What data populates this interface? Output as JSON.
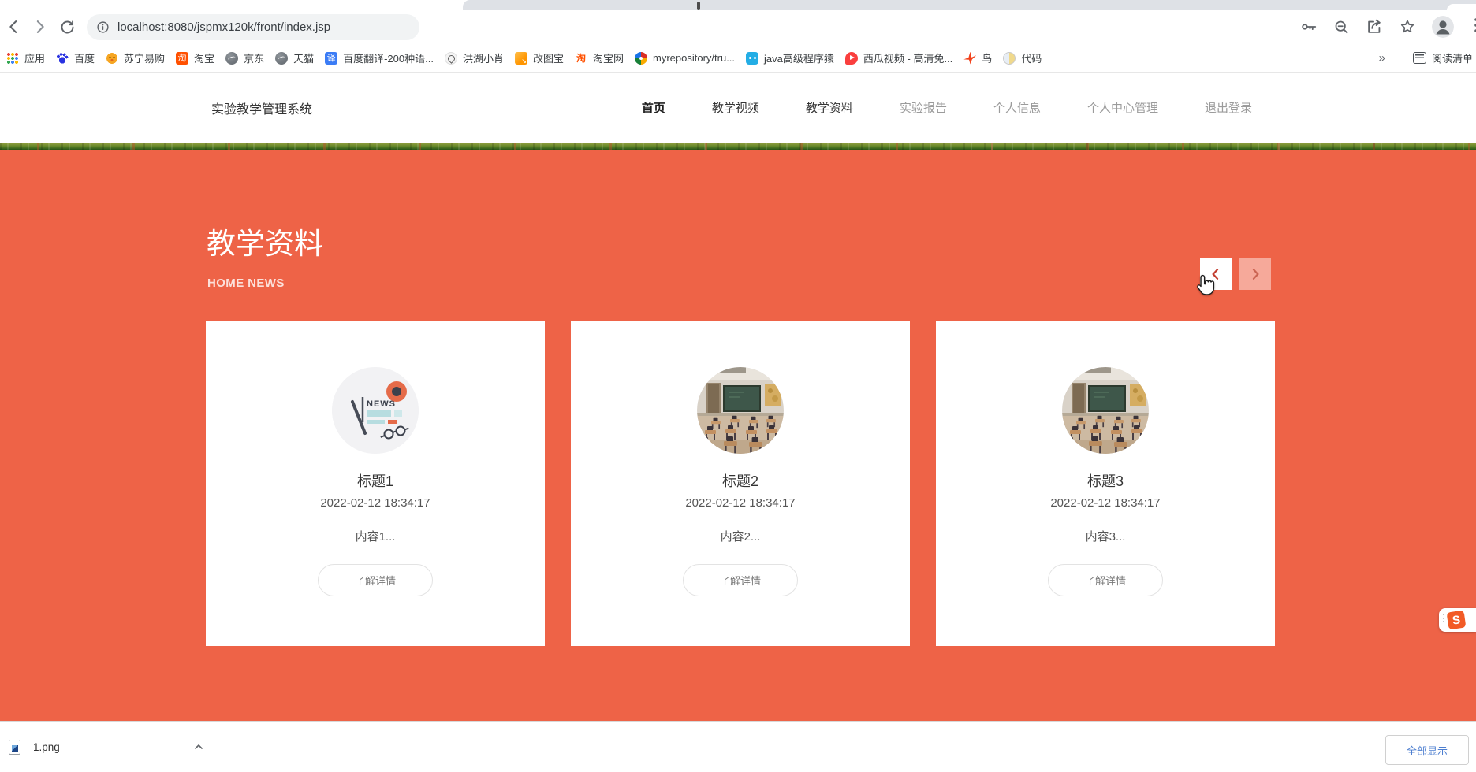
{
  "browser": {
    "url": "localhost:8080/jspmx120k/front/index.jsp",
    "bookmarks": [
      {
        "label": "应用",
        "icon": "apps"
      },
      {
        "label": "百度",
        "icon": "baidu-paw"
      },
      {
        "label": "苏宁易购",
        "icon": "suning-lion"
      },
      {
        "label": "淘宝",
        "icon": "taobao"
      },
      {
        "label": "京东",
        "icon": "globe"
      },
      {
        "label": "天猫",
        "icon": "globe"
      },
      {
        "label": "百度翻译-200种语...",
        "icon": "translate"
      },
      {
        "label": "洪湖小肖",
        "icon": "bird-sketch"
      },
      {
        "label": "改图宝",
        "icon": "gaitubao"
      },
      {
        "label": "淘宝网",
        "icon": "taobao-text"
      },
      {
        "label": "myrepository/tru...",
        "icon": "repo-swirl"
      },
      {
        "label": "java高级程序猿",
        "icon": "bilibili-tv"
      },
      {
        "label": "西瓜视频 - 高清免...",
        "icon": "xigua"
      },
      {
        "label": "鸟",
        "icon": "bird-red"
      },
      {
        "label": "代码",
        "icon": "code-moon"
      }
    ],
    "overflow_chevron": "»",
    "reading_list_label": "阅读清单"
  },
  "site_header": {
    "brand": "实验教学管理系统",
    "nav": [
      {
        "label": "首页",
        "style": "bold"
      },
      {
        "label": "教学视频",
        "style": "dark"
      },
      {
        "label": "教学资料",
        "style": "dark"
      },
      {
        "label": "实验报告",
        "style": "muted"
      },
      {
        "label": "个人信息",
        "style": "muted"
      },
      {
        "label": "个人中心管理",
        "style": "muted"
      },
      {
        "label": "退出登录",
        "style": "muted"
      }
    ]
  },
  "hero": {
    "title": "教学资料",
    "subtitle": "HOME NEWS",
    "background_color": "#ee6347"
  },
  "cards": [
    {
      "title": "标题1",
      "date": "2022-02-12 18:34:17",
      "content": "内容1...",
      "button_label": "了解详情",
      "image": "news-illustration"
    },
    {
      "title": "标题2",
      "date": "2022-02-12 18:34:17",
      "content": "内容2...",
      "button_label": "了解详情",
      "image": "classroom-photo"
    },
    {
      "title": "标题3",
      "date": "2022-02-12 18:34:17",
      "content": "内容3...",
      "button_label": "了解详情",
      "image": "classroom-photo"
    }
  ],
  "download_bar": {
    "file_name": "1.png",
    "show_all_label": "全部显示"
  },
  "side_widget": {
    "letter": "S"
  }
}
